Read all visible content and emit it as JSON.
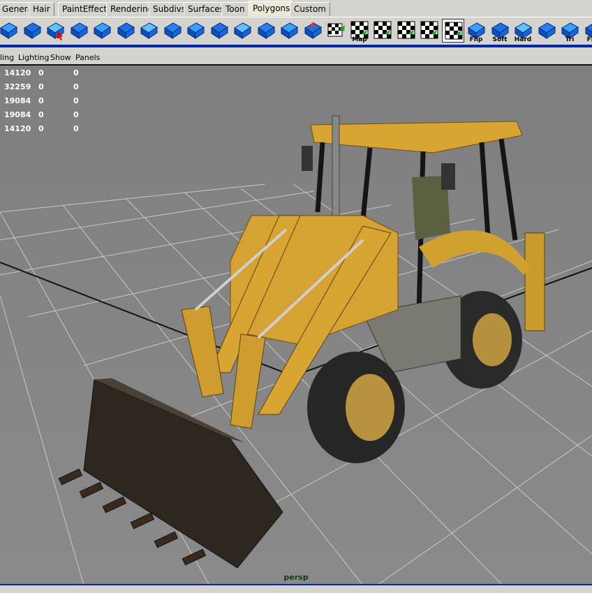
{
  "shelf_tabs": [
    {
      "label": "General",
      "active": false
    },
    {
      "label": "Hair",
      "active": false
    },
    {
      "label": "PaintEffects",
      "active": false
    },
    {
      "label": "Rendering",
      "active": false
    },
    {
      "label": "Subdivs",
      "active": false
    },
    {
      "label": "Surfaces",
      "active": false
    },
    {
      "label": "Toon",
      "active": false
    },
    {
      "label": "Polygons",
      "active": true
    },
    {
      "label": "Custom",
      "active": false
    }
  ],
  "shelf_icons": [
    {
      "name": "poly-cube-icon",
      "label": ""
    },
    {
      "name": "poly-plane-icon",
      "label": ""
    },
    {
      "name": "select-tool-icon",
      "label": ""
    },
    {
      "name": "poly-extrude-icon",
      "label": ""
    },
    {
      "name": "poly-wedge-icon",
      "label": ""
    },
    {
      "name": "poly-bevel-icon",
      "label": ""
    },
    {
      "name": "poly-chamfer-icon",
      "label": ""
    },
    {
      "name": "poly-split-icon",
      "label": ""
    },
    {
      "name": "poly-subdivide-icon",
      "label": ""
    },
    {
      "name": "poly-merge-icon",
      "label": ""
    },
    {
      "name": "poly-cut-icon",
      "label": ""
    },
    {
      "name": "poly-duplicate-icon",
      "label": ""
    },
    {
      "name": "poly-combine-icon",
      "label": ""
    },
    {
      "name": "poly-separate-icon",
      "label": ""
    },
    {
      "name": "uv-planar-icon",
      "label": ""
    },
    {
      "name": "uv-map-icon",
      "label": "Map"
    },
    {
      "name": "uv-cylindrical-icon",
      "label": ""
    },
    {
      "name": "uv-spherical-icon",
      "label": ""
    },
    {
      "name": "uv-auto-icon",
      "label": ""
    },
    {
      "name": "uv-editor-icon",
      "label": ""
    },
    {
      "name": "normals-flip-icon",
      "label": "Flip"
    },
    {
      "name": "normals-soft-icon",
      "label": "Soft"
    },
    {
      "name": "normals-hard-icon",
      "label": "Hard"
    },
    {
      "name": "poly-smooth-icon",
      "label": ""
    },
    {
      "name": "triangulate-icon",
      "label": "Tri"
    },
    {
      "name": "flip-edge-icon",
      "label": "Flip"
    }
  ],
  "panel_menu": [
    "ling",
    "Lighting",
    "Show",
    "Panels"
  ],
  "hud_rows": [
    [
      "14120",
      "0",
      "0"
    ],
    [
      "32259",
      "0",
      "0"
    ],
    [
      "19084",
      "0",
      "0"
    ],
    [
      "19084",
      "0",
      "0"
    ],
    [
      "14120",
      "0",
      "0"
    ]
  ],
  "camera_label": "persp",
  "colors": {
    "accent": "#0a24a8",
    "shelf_bg": "#d6d3ce",
    "viewport_bg": "#858585",
    "machine_yellow": "#d9a532"
  }
}
